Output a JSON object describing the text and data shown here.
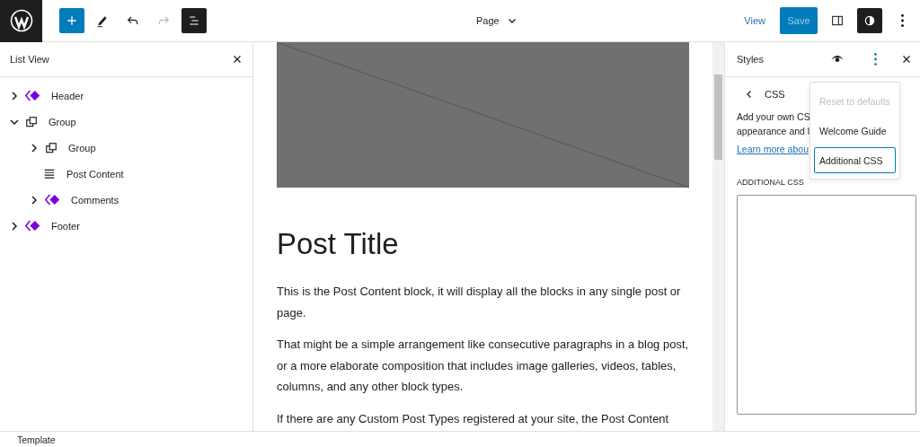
{
  "toolbar": {
    "document": "Page",
    "view": "View",
    "save": "Save",
    "save_disabled": true,
    "list_view_active": true,
    "styles_active": true
  },
  "list_view": {
    "title": "List View",
    "items": [
      {
        "label": "Header",
        "kind": "template-part",
        "expanded": false
      },
      {
        "label": "Group",
        "kind": "group",
        "expanded": true,
        "children": [
          {
            "label": "Group",
            "kind": "group",
            "expanded": false
          },
          {
            "label": "Post Content",
            "kind": "post-content"
          },
          {
            "label": "Comments",
            "kind": "template-part",
            "expanded": false
          }
        ]
      },
      {
        "label": "Footer",
        "kind": "template-part",
        "expanded": false
      }
    ]
  },
  "canvas": {
    "title": "Post Title",
    "paragraphs": [
      "This is the Post Content block, it will display all the blocks in any single post or page.",
      "That might be a simple arrangement like consecutive paragraphs in a blog post, or a more elaborate composition that includes image galleries, videos, tables, columns, and any other block types.",
      "If there are any Custom Post Types registered at your site, the Post Content"
    ]
  },
  "styles": {
    "title": "Styles",
    "section": "CSS",
    "description_lines": [
      "Add your own CS",
      "appearance and l"
    ],
    "link": "Learn more abou",
    "field_label": "ADDITIONAL CSS",
    "menu": [
      {
        "label": "Reset to defaults",
        "disabled": true,
        "selected": false
      },
      {
        "label": "Welcome Guide",
        "disabled": false,
        "selected": false
      },
      {
        "label": "Additional CSS",
        "disabled": false,
        "selected": true
      }
    ]
  },
  "footer": {
    "breadcrumb": "Template"
  }
}
